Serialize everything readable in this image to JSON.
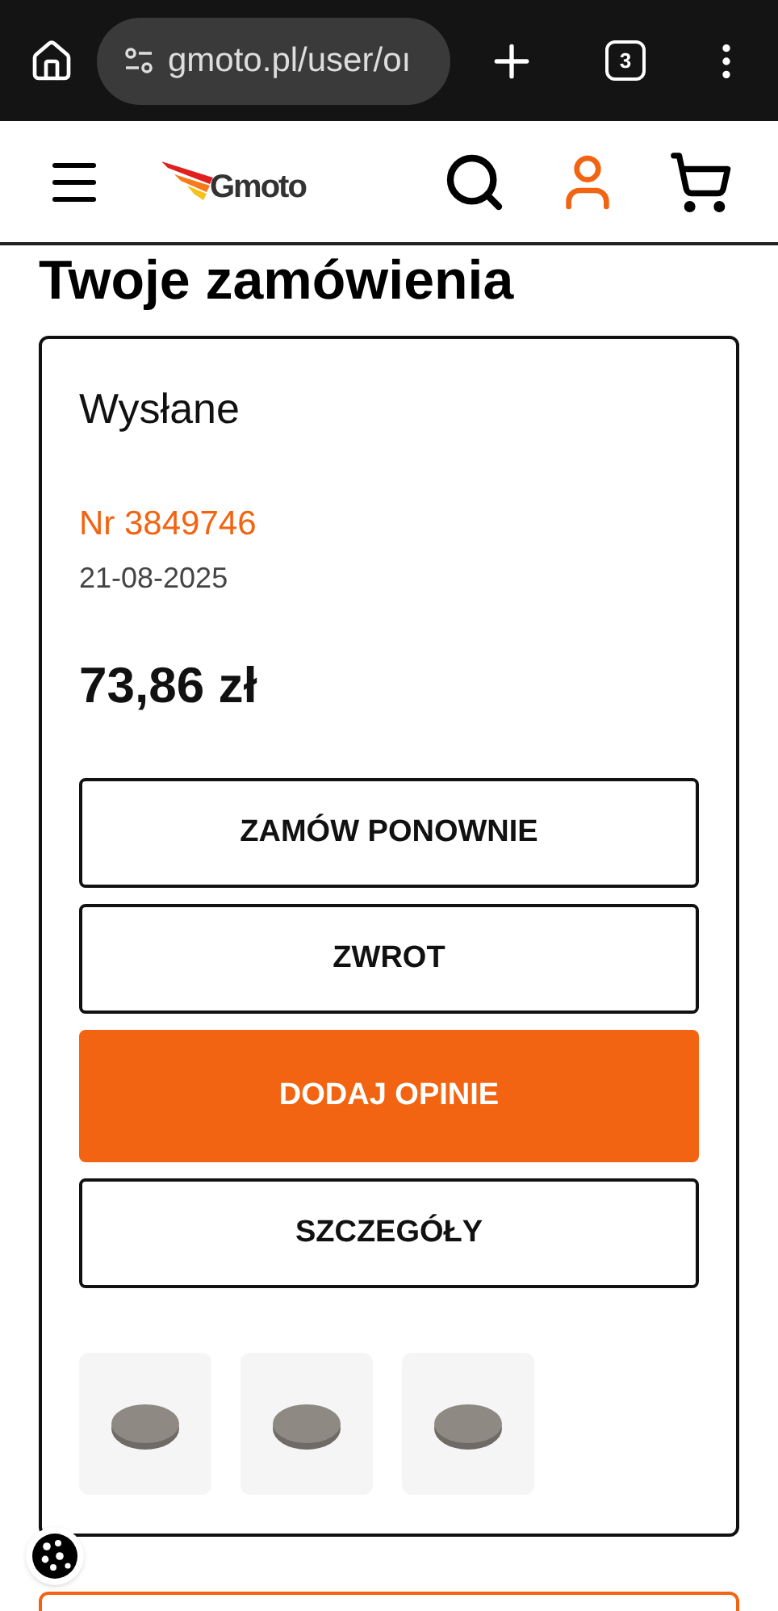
{
  "browser": {
    "url": "gmoto.pl/user/oı",
    "tab_count": "3"
  },
  "header": {
    "logo": "Gmoto"
  },
  "page_title": "Twoje zamówienia",
  "order": {
    "status": "Wysłane",
    "number": "Nr 3849746",
    "date": "21-08-2025",
    "total": "73,86 zł",
    "buttons": [
      {
        "label": "ZAMÓW PONOWNIE",
        "kind": "outline"
      },
      {
        "label": "ZWROT",
        "kind": "outline"
      },
      {
        "label": "DODAJ OPINIE",
        "kind": "primary"
      },
      {
        "label": "SZCZEGÓŁY",
        "kind": "outline"
      }
    ]
  }
}
